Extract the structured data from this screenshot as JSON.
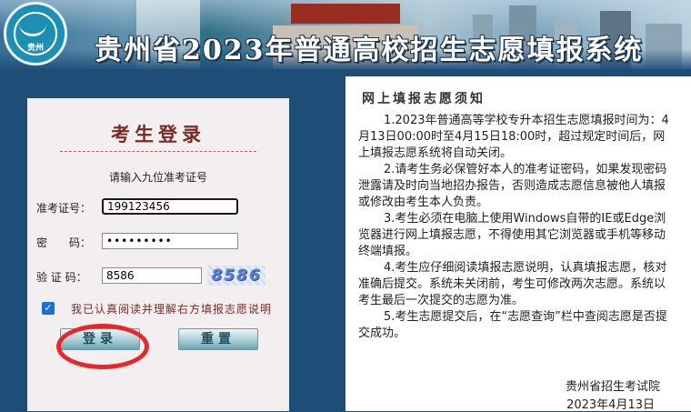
{
  "header": {
    "logo_text": "贵州",
    "site_title": "贵州省2023年普通高校招生志愿填报系统"
  },
  "login": {
    "title": "考生登录",
    "hint": "请输入九位准考证号",
    "exam_id_label": "准考证号：",
    "exam_id_value": "199123456",
    "password_label": "密　　码：",
    "password_value": "•••••••••",
    "captcha_label": "验 证 码：",
    "captcha_value": "8586",
    "captcha_image_text": "8586",
    "agree_checked": true,
    "agree_mark": "✓",
    "agree_label": "我已认真阅读并理解右方填报志愿说明",
    "login_button": "登录",
    "reset_button": "重置"
  },
  "notice": {
    "title": "网上填报志愿须知",
    "items": [
      "1.2023年普通高等学校专升本招生志愿填报时间为：4月13日00:00时至4月15日18:00时，超过规定时间后，网上填报志愿系统将自动关闭。",
      "2.请考生务必保管好本人的准考证密码，如果发现密码泄露请及时向当地招办报告，否则造成志愿信息被他人填报或修改由考生本人负责。",
      "3.考生必须在电脑上使用Windows自带的IE或Edge浏览器进行网上填报志愿，不得使用其它浏览器或手机等移动终端填报。",
      "4.考生应仔细阅读填报志愿说明，认真填报志愿，核对准确后提交。系统未关闭前，考生可修改两次志愿。系统以考生最后一次提交的志愿为准。",
      "5.考生志愿提交后，在“志愿查询”栏中查阅志愿是否提交成功。"
    ],
    "org": "贵州省招生考试院",
    "date": "2023年4月13日"
  },
  "colors": {
    "background": "#1e4d78",
    "title_accent": "#7a2b24",
    "highlight": "#e8272a"
  }
}
